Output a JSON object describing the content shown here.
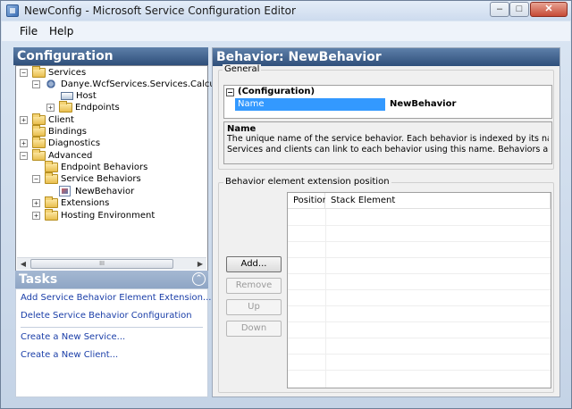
{
  "window": {
    "title": "NewConfig - Microsoft Service Configuration Editor",
    "min_glyph": "–",
    "max_glyph": "□",
    "close_glyph": "✕"
  },
  "menu": {
    "file": "File",
    "help": "Help"
  },
  "configuration": {
    "header": "Configuration",
    "tree": [
      {
        "label": "Services",
        "icon": "folder-icon",
        "expander": "−"
      },
      {
        "label": "Danye.WcfServices.Services.CalculatorS",
        "icon": "service-icon",
        "expander": "−"
      },
      {
        "label": "Host",
        "icon": "host-icon",
        "expander": ""
      },
      {
        "label": "Endpoints",
        "icon": "folder-icon",
        "expander": "+"
      },
      {
        "label": "Client",
        "icon": "folder-icon",
        "expander": "+"
      },
      {
        "label": "Bindings",
        "icon": "folder-icon",
        "expander": ""
      },
      {
        "label": "Diagnostics",
        "icon": "folder-icon",
        "expander": "+"
      },
      {
        "label": "Advanced",
        "icon": "folder-icon",
        "expander": "−"
      },
      {
        "label": "Endpoint Behaviors",
        "icon": "folder-icon",
        "expander": ""
      },
      {
        "label": "Service Behaviors",
        "icon": "folder-icon",
        "expander": "−"
      },
      {
        "label": "NewBehavior",
        "icon": "behavior-icon",
        "expander": ""
      },
      {
        "label": "Extensions",
        "icon": "folder-icon",
        "expander": "+"
      },
      {
        "label": "Hosting Environment",
        "icon": "folder-icon",
        "expander": "+"
      }
    ],
    "scroll_left": "◀",
    "scroll_right": "▶",
    "scroll_grip": "III"
  },
  "tasks": {
    "header": "Tasks",
    "collapse_glyph": "⌃",
    "links": [
      "Add Service Behavior Element Extension...",
      "Delete Service Behavior Configuration",
      "Create a New Service...",
      "Create a New Client..."
    ]
  },
  "behavior": {
    "header": "Behavior: NewBehavior",
    "general_title": "General",
    "category": "(Configuration)",
    "category_toggle": "−",
    "prop_name": "Name",
    "prop_value": "NewBehavior",
    "desc_title": "Name",
    "desc_line1": "The unique name of the service behavior. Each behavior is indexed by its name.",
    "desc_line2": "Services and clients can link to each behavior using this name. Behaviors are define...",
    "ext_title": "Behavior element extension position",
    "buttons": {
      "add": "Add...",
      "remove": "Remove",
      "up": "Up",
      "down": "Down"
    },
    "columns": {
      "position": "Position",
      "stack_element": "Stack Element"
    }
  }
}
